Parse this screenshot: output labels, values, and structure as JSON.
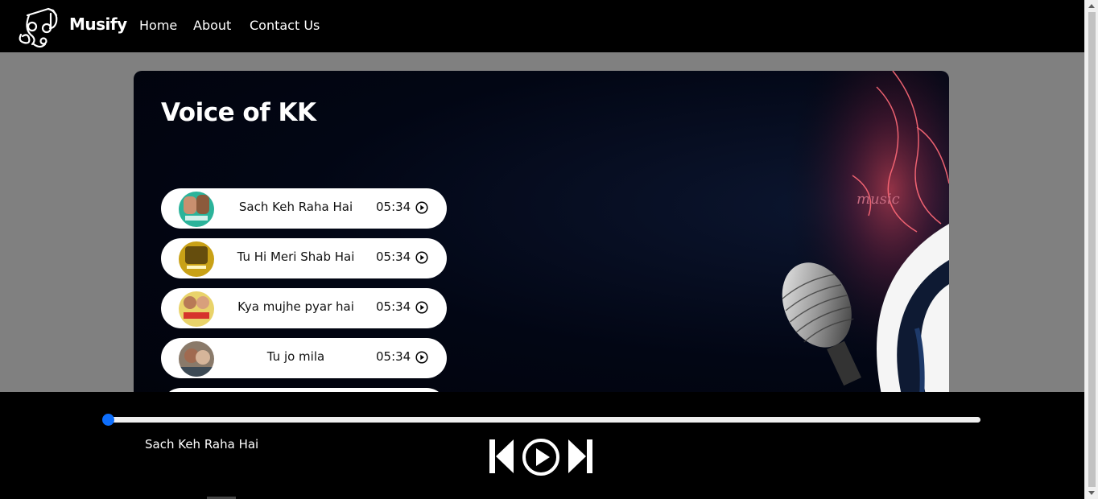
{
  "nav": {
    "brand": "Musify",
    "links": [
      "Home",
      "About",
      "Contact Us"
    ]
  },
  "card": {
    "title": "Voice of KK",
    "songs": [
      {
        "name": "Sach Keh Raha Hai",
        "duration": "05:34"
      },
      {
        "name": "Tu Hi Meri Shab Hai",
        "duration": "05:34"
      },
      {
        "name": "Kya mujhe pyar hai",
        "duration": "05:34"
      },
      {
        "name": "Tu jo mila",
        "duration": "05:34"
      }
    ]
  },
  "player": {
    "now_playing": "Sach Keh Raha Hai",
    "progress": 0
  },
  "colors": {
    "navbar": "#000000",
    "page_bg": "#808080",
    "accent": "#0d6efd",
    "song_pill": "#ffffff"
  },
  "icons": {
    "logo": "music-note-logo-icon",
    "play": "play-circle-icon",
    "prev": "skip-previous-icon",
    "next": "skip-next-icon"
  }
}
